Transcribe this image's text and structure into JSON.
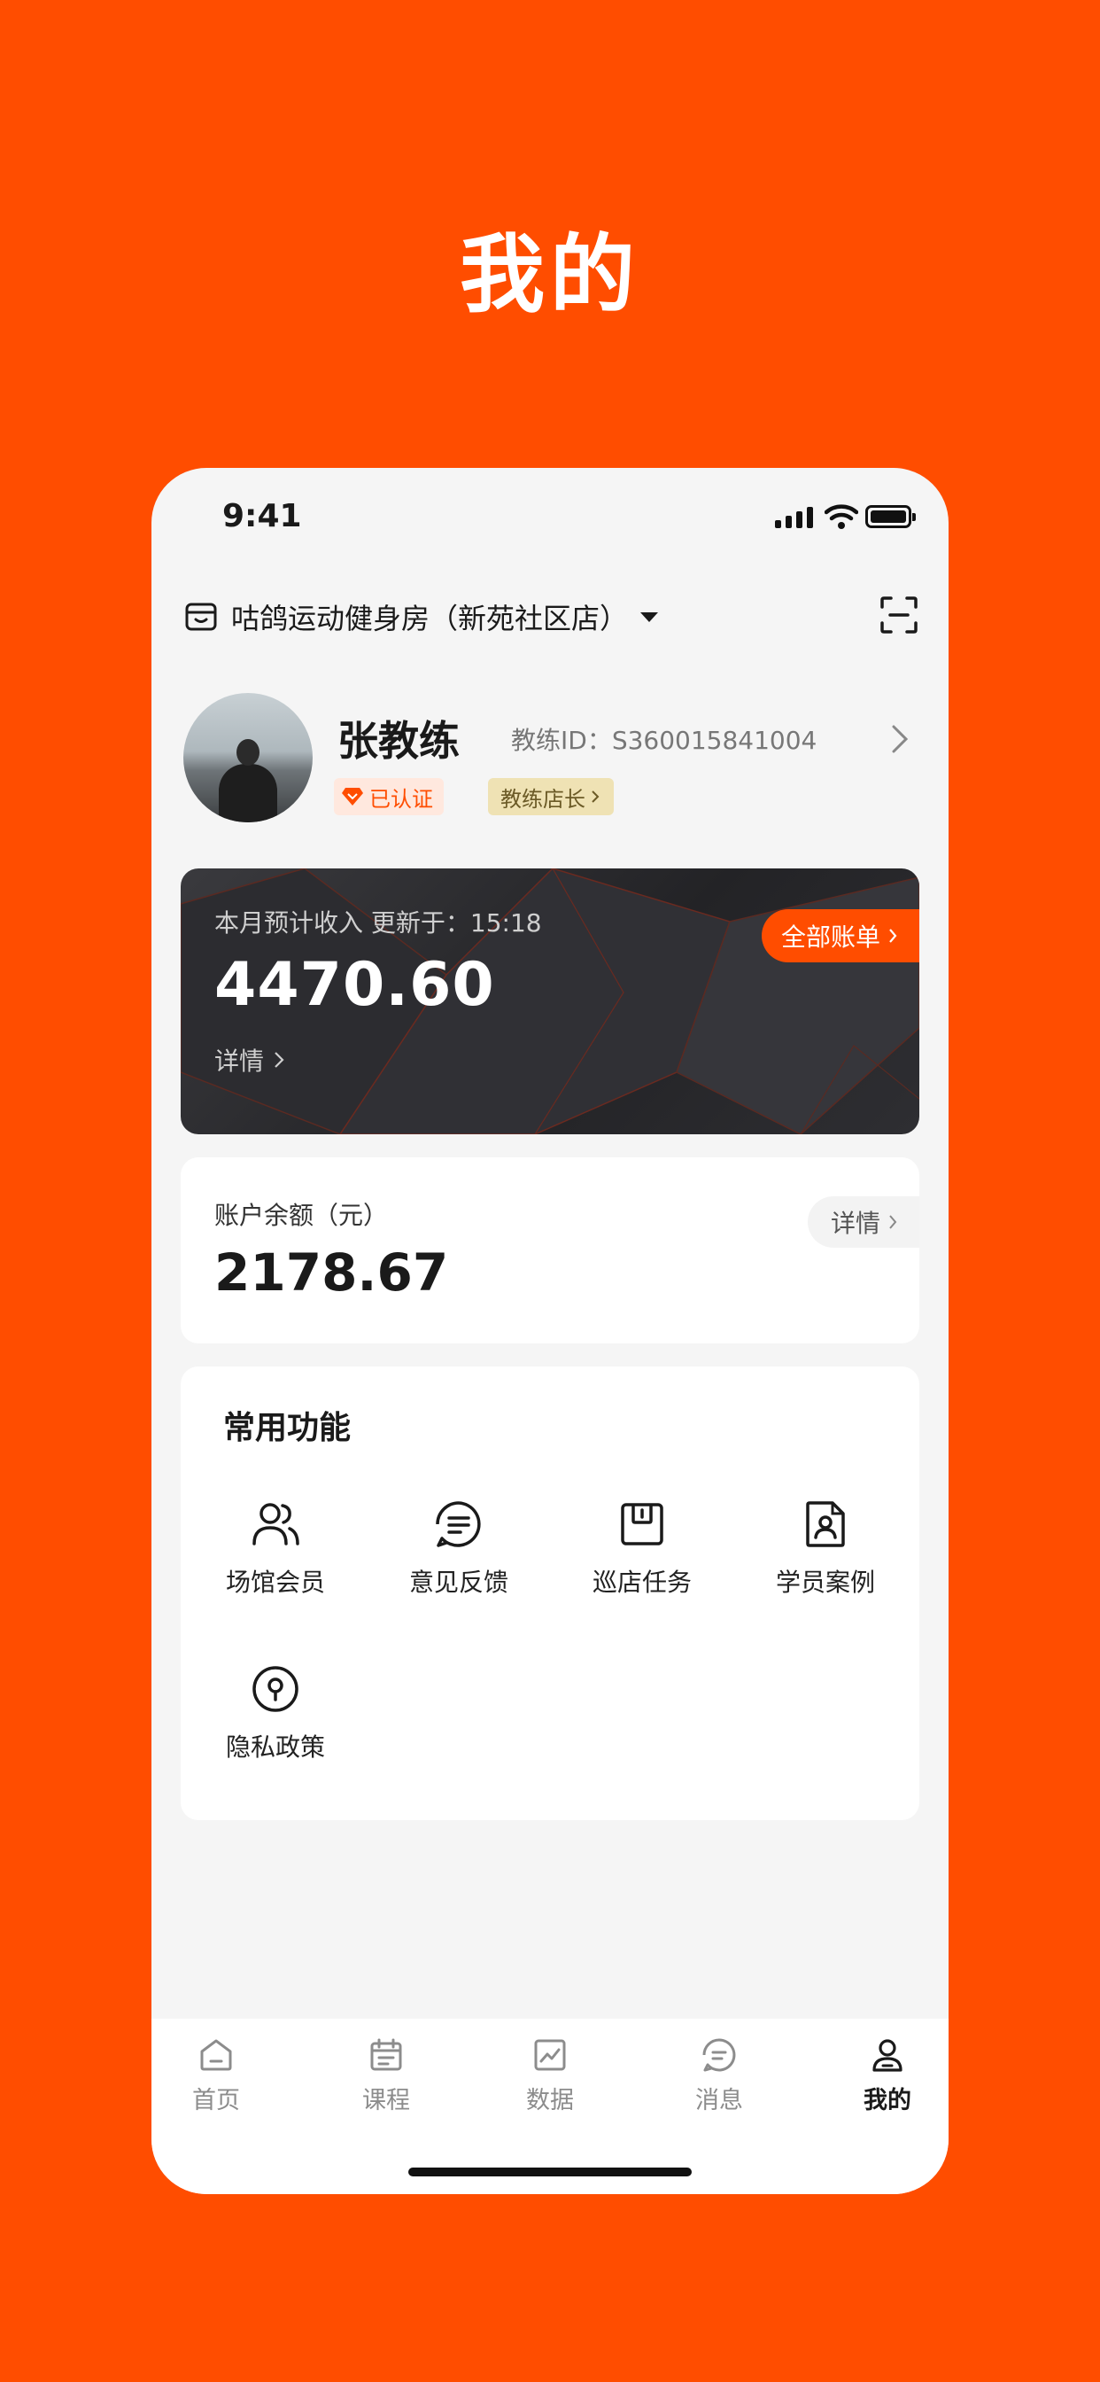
{
  "hero": {
    "title": "我的"
  },
  "status_bar": {
    "time": "9:41"
  },
  "store": {
    "name": "咕鸽运动健身房（新苑社区店）"
  },
  "profile": {
    "name": "张教练",
    "coach_id": "教练ID：S360015841004",
    "verified_badge": "已认证",
    "role_badge": "教练店长"
  },
  "income": {
    "label": "本月预计收入   更新于：15:18",
    "value": "4470.60",
    "detail_label": "详情",
    "all_bills_label": "全部账单"
  },
  "balance": {
    "label": "账户余额（元）",
    "value": "2178.67",
    "detail_label": "详情"
  },
  "functions": {
    "title": "常用功能",
    "items": [
      {
        "label": "场馆会员",
        "icon": "members-icon"
      },
      {
        "label": "意见反馈",
        "icon": "feedback-icon"
      },
      {
        "label": "巡店任务",
        "icon": "patrol-task-icon"
      },
      {
        "label": "学员案例",
        "icon": "student-case-icon"
      },
      {
        "label": "隐私政策",
        "icon": "privacy-lock-icon"
      }
    ]
  },
  "tabbar": {
    "items": [
      {
        "label": "首页",
        "icon": "home-icon"
      },
      {
        "label": "课程",
        "icon": "calendar-icon"
      },
      {
        "label": "数据",
        "icon": "chart-icon"
      },
      {
        "label": "消息",
        "icon": "message-icon"
      },
      {
        "label": "我的",
        "icon": "user-icon",
        "active": true
      }
    ]
  },
  "colors": {
    "accent": "#FF4D00",
    "card_dark": "#26262A",
    "page_bg": "#F5F5F5"
  }
}
